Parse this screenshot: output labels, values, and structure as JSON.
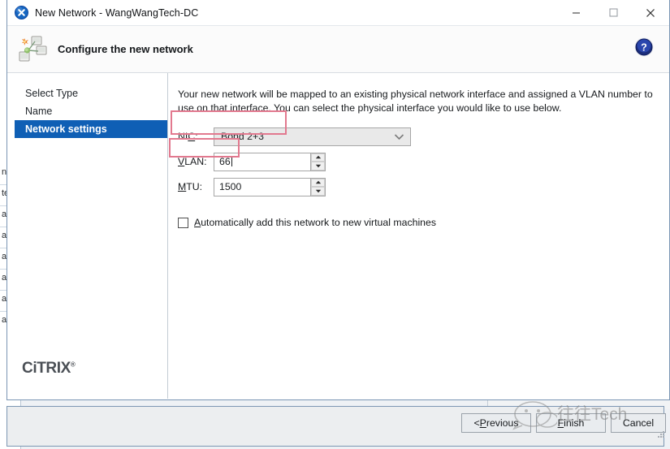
{
  "window": {
    "title": "New Network - WangWangTech-DC",
    "icon": "xencenter-app-icon",
    "controls": {
      "minimize": "—",
      "maximize": "□",
      "close": "✕"
    }
  },
  "header": {
    "title": "Configure the new network",
    "icon": "network-diagram-icon",
    "help_icon": "help-question-icon",
    "help_label": "?"
  },
  "sidebar": {
    "items": [
      {
        "label": "Select Type",
        "selected": false
      },
      {
        "label": "Name",
        "selected": false
      },
      {
        "label": "Network settings",
        "selected": true
      }
    ],
    "logo": "CiTRIX",
    "logo_tm": "®",
    "selected_color": "#0f5fb5"
  },
  "content": {
    "intro": "Your new network will be mapped to an existing physical network interface and assigned a VLAN number to use on that interface. You can select the physical interface you would like to use below.",
    "fields": [
      {
        "id": "nic",
        "label_prefix": "NI",
        "label_accel": "C",
        "label_suffix": ":",
        "type": "combobox",
        "value": "Bond 2+3",
        "annotated": true
      },
      {
        "id": "vlan",
        "label_prefix": "",
        "label_accel": "V",
        "label_suffix": "LAN:",
        "type": "spinner",
        "value": "66",
        "annotated": true
      },
      {
        "id": "mtu",
        "label_prefix": "",
        "label_accel": "M",
        "label_suffix": "TU:",
        "type": "spinner",
        "value": "1500",
        "annotated": false
      }
    ],
    "checkbox": {
      "checked": false,
      "accel": "A",
      "label_rest": "utomatically add this network to new virtual machines"
    },
    "annotation_color": "#e2798f"
  },
  "buttons": {
    "previous": {
      "prefix": "< ",
      "accel": "P",
      "rest": "revious"
    },
    "finish": {
      "prefix": "",
      "accel": "F",
      "rest": "inish"
    },
    "cancel": {
      "prefix": "",
      "accel": "C",
      "rest": "ancel"
    }
  },
  "watermark": {
    "text": "往往Tech",
    "icon": "wechat-bubble-icon"
  },
  "background": {
    "fragments": [
      "nf",
      "te",
      "an",
      "an",
      "an",
      "an",
      "an",
      "an"
    ]
  }
}
